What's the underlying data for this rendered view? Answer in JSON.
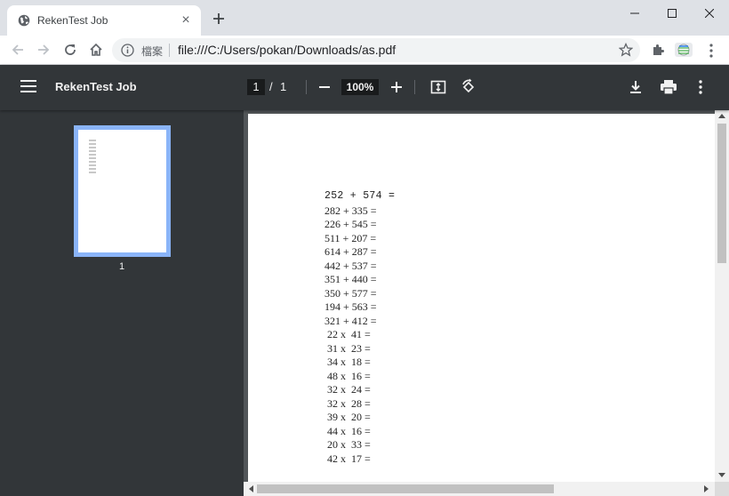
{
  "browser": {
    "tab_title": "RekenTest Job",
    "url": "file:///C:/Users/pokan/Downloads/as.pdf",
    "site_label": "檔案"
  },
  "pdf": {
    "title": "RekenTest Job",
    "current_page": "1",
    "page_separator": "/",
    "total_pages": "1",
    "zoom": "100%",
    "thumbnail_label": "1"
  },
  "document_lines": [
    "252 + 574 =",
    "282 + 335 =",
    "226 + 545 =",
    "511 + 207 =",
    "614 + 287 =",
    "442 + 537 =",
    "351 + 440 =",
    "350 + 577 =",
    "194 + 563 =",
    "321 + 412 =",
    " 22 x  41 =",
    " 31 x  23 =",
    " 34 x  18 =",
    " 48 x  16 =",
    " 32 x  24 =",
    " 32 x  28 =",
    " 39 x  20 =",
    " 44 x  16 =",
    " 20 x  33 =",
    " 42 x  17 ="
  ],
  "icons": {
    "favicon": "globe-icon",
    "tab_close": "close-icon",
    "new_tab": "plus-icon",
    "back": "arrow-left-icon",
    "forward": "arrow-right-icon",
    "reload": "reload-icon",
    "home": "home-icon",
    "info": "info-icon",
    "star": "star-icon",
    "extensions": "puzzle-icon",
    "profile": "profile-icon",
    "chrome_menu": "vertical-dots-icon",
    "pdf_menu": "hamburger-icon",
    "zoom_out": "minus-icon",
    "zoom_in": "plus-icon",
    "fit": "fit-page-icon",
    "rotate": "rotate-icon",
    "download": "download-icon",
    "print": "print-icon",
    "more": "vertical-dots-icon"
  },
  "colors": {
    "pdf_toolbar": "#323639",
    "viewer_background": "#525659",
    "thumbnail_border": "#8ab4f8",
    "tab_strip": "#dee1e6"
  }
}
